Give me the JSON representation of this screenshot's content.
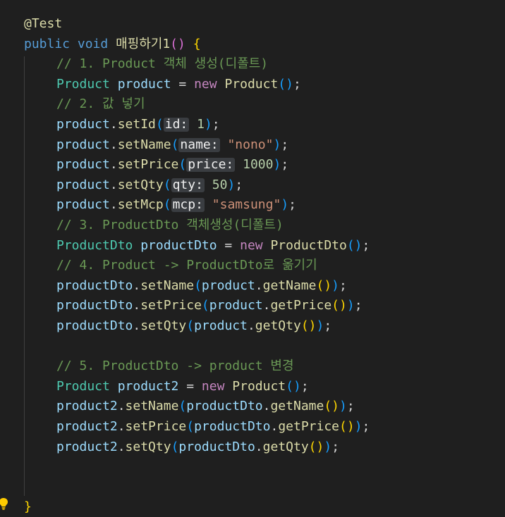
{
  "editor": {
    "colors": {
      "background": "#1f1f1f",
      "plain": "#d4d4d4",
      "keyword": "#569cd6",
      "control_keyword": "#c586c0",
      "type": "#4ec9b0",
      "variable": "#9cdcfe",
      "method": "#dcdcaa",
      "string": "#ce9178",
      "number": "#b5cea8",
      "comment": "#6a9955",
      "annotation": "#dcdcaa",
      "bracket_gold": "#ffd700",
      "bracket_purple": "#da70d6",
      "bracket_blue": "#179fff",
      "inlay_hint_bg": "#3a3d41",
      "lightbulb": "#ffcc00"
    },
    "lines": [
      {
        "indent": 0,
        "tokens": [
          {
            "t": "@Test",
            "k": "annotation"
          }
        ]
      },
      {
        "indent": 0,
        "tokens": [
          {
            "t": "public",
            "k": "keyword"
          },
          {
            "t": " ",
            "k": "plain"
          },
          {
            "t": "void",
            "k": "keyword"
          },
          {
            "t": " ",
            "k": "plain"
          },
          {
            "t": "매핑하기1",
            "k": "method"
          },
          {
            "t": "()",
            "k": "bracket_purple"
          },
          {
            "t": " ",
            "k": "plain"
          },
          {
            "t": "{",
            "k": "bracket_gold"
          }
        ]
      },
      {
        "indent": 1,
        "tokens": [
          {
            "t": "// 1. Product 객체 생성(디폴트)",
            "k": "comment"
          }
        ]
      },
      {
        "indent": 1,
        "tokens": [
          {
            "t": "Product",
            "k": "type"
          },
          {
            "t": " ",
            "k": "plain"
          },
          {
            "t": "product",
            "k": "variable"
          },
          {
            "t": " = ",
            "k": "plain"
          },
          {
            "t": "new",
            "k": "control_keyword"
          },
          {
            "t": " ",
            "k": "plain"
          },
          {
            "t": "Product",
            "k": "method"
          },
          {
            "t": "()",
            "k": "bracket_blue"
          },
          {
            "t": ";",
            "k": "plain"
          }
        ]
      },
      {
        "indent": 1,
        "tokens": [
          {
            "t": "// 2. 값 넣기",
            "k": "comment"
          }
        ]
      },
      {
        "indent": 1,
        "tokens": [
          {
            "t": "product",
            "k": "variable"
          },
          {
            "t": ".",
            "k": "plain"
          },
          {
            "t": "setId",
            "k": "method"
          },
          {
            "t": "(",
            "k": "bracket_blue"
          },
          {
            "t": "id:",
            "k": "hint"
          },
          {
            "t": " ",
            "k": "plain"
          },
          {
            "t": "1",
            "k": "number"
          },
          {
            "t": ")",
            "k": "bracket_blue"
          },
          {
            "t": ";",
            "k": "plain"
          }
        ]
      },
      {
        "indent": 1,
        "tokens": [
          {
            "t": "product",
            "k": "variable"
          },
          {
            "t": ".",
            "k": "plain"
          },
          {
            "t": "setName",
            "k": "method"
          },
          {
            "t": "(",
            "k": "bracket_blue"
          },
          {
            "t": "name:",
            "k": "hint"
          },
          {
            "t": " ",
            "k": "plain"
          },
          {
            "t": "\"nono\"",
            "k": "string"
          },
          {
            "t": ")",
            "k": "bracket_blue"
          },
          {
            "t": ";",
            "k": "plain"
          }
        ]
      },
      {
        "indent": 1,
        "tokens": [
          {
            "t": "product",
            "k": "variable"
          },
          {
            "t": ".",
            "k": "plain"
          },
          {
            "t": "setPrice",
            "k": "method"
          },
          {
            "t": "(",
            "k": "bracket_blue"
          },
          {
            "t": "price:",
            "k": "hint"
          },
          {
            "t": " ",
            "k": "plain"
          },
          {
            "t": "1000",
            "k": "number"
          },
          {
            "t": ")",
            "k": "bracket_blue"
          },
          {
            "t": ";",
            "k": "plain"
          }
        ]
      },
      {
        "indent": 1,
        "tokens": [
          {
            "t": "product",
            "k": "variable"
          },
          {
            "t": ".",
            "k": "plain"
          },
          {
            "t": "setQty",
            "k": "method"
          },
          {
            "t": "(",
            "k": "bracket_blue"
          },
          {
            "t": "qty:",
            "k": "hint"
          },
          {
            "t": " ",
            "k": "plain"
          },
          {
            "t": "50",
            "k": "number"
          },
          {
            "t": ")",
            "k": "bracket_blue"
          },
          {
            "t": ";",
            "k": "plain"
          }
        ]
      },
      {
        "indent": 1,
        "tokens": [
          {
            "t": "product",
            "k": "variable"
          },
          {
            "t": ".",
            "k": "plain"
          },
          {
            "t": "setMcp",
            "k": "method"
          },
          {
            "t": "(",
            "k": "bracket_blue"
          },
          {
            "t": "mcp:",
            "k": "hint"
          },
          {
            "t": " ",
            "k": "plain"
          },
          {
            "t": "\"samsung\"",
            "k": "string"
          },
          {
            "t": ")",
            "k": "bracket_blue"
          },
          {
            "t": ";",
            "k": "plain"
          }
        ]
      },
      {
        "indent": 1,
        "tokens": [
          {
            "t": "// 3. ProductDto 객체생성(디폴트)",
            "k": "comment"
          }
        ]
      },
      {
        "indent": 1,
        "tokens": [
          {
            "t": "ProductDto",
            "k": "type"
          },
          {
            "t": " ",
            "k": "plain"
          },
          {
            "t": "productDto",
            "k": "variable"
          },
          {
            "t": " = ",
            "k": "plain"
          },
          {
            "t": "new",
            "k": "control_keyword"
          },
          {
            "t": " ",
            "k": "plain"
          },
          {
            "t": "ProductDto",
            "k": "method"
          },
          {
            "t": "()",
            "k": "bracket_blue"
          },
          {
            "t": ";",
            "k": "plain"
          }
        ]
      },
      {
        "indent": 1,
        "tokens": [
          {
            "t": "// 4. Product -> ProductDto로 옮기기",
            "k": "comment"
          }
        ]
      },
      {
        "indent": 1,
        "tokens": [
          {
            "t": "productDto",
            "k": "variable"
          },
          {
            "t": ".",
            "k": "plain"
          },
          {
            "t": "setName",
            "k": "method"
          },
          {
            "t": "(",
            "k": "bracket_blue"
          },
          {
            "t": "product",
            "k": "variable"
          },
          {
            "t": ".",
            "k": "plain"
          },
          {
            "t": "getName",
            "k": "method"
          },
          {
            "t": "()",
            "k": "bracket_gold"
          },
          {
            "t": ")",
            "k": "bracket_blue"
          },
          {
            "t": ";",
            "k": "plain"
          }
        ]
      },
      {
        "indent": 1,
        "tokens": [
          {
            "t": "productDto",
            "k": "variable"
          },
          {
            "t": ".",
            "k": "plain"
          },
          {
            "t": "setPrice",
            "k": "method"
          },
          {
            "t": "(",
            "k": "bracket_blue"
          },
          {
            "t": "product",
            "k": "variable"
          },
          {
            "t": ".",
            "k": "plain"
          },
          {
            "t": "getPrice",
            "k": "method"
          },
          {
            "t": "()",
            "k": "bracket_gold"
          },
          {
            "t": ")",
            "k": "bracket_blue"
          },
          {
            "t": ";",
            "k": "plain"
          }
        ]
      },
      {
        "indent": 1,
        "tokens": [
          {
            "t": "productDto",
            "k": "variable"
          },
          {
            "t": ".",
            "k": "plain"
          },
          {
            "t": "setQty",
            "k": "method"
          },
          {
            "t": "(",
            "k": "bracket_blue"
          },
          {
            "t": "product",
            "k": "variable"
          },
          {
            "t": ".",
            "k": "plain"
          },
          {
            "t": "getQty",
            "k": "method"
          },
          {
            "t": "()",
            "k": "bracket_gold"
          },
          {
            "t": ")",
            "k": "bracket_blue"
          },
          {
            "t": ";",
            "k": "plain"
          }
        ]
      },
      {
        "indent": 0,
        "tokens": []
      },
      {
        "indent": 1,
        "tokens": [
          {
            "t": "// 5. ProductDto -> product 변경",
            "k": "comment"
          }
        ]
      },
      {
        "indent": 1,
        "tokens": [
          {
            "t": "Product",
            "k": "type"
          },
          {
            "t": " ",
            "k": "plain"
          },
          {
            "t": "product2",
            "k": "variable"
          },
          {
            "t": " = ",
            "k": "plain"
          },
          {
            "t": "new",
            "k": "control_keyword"
          },
          {
            "t": " ",
            "k": "plain"
          },
          {
            "t": "Product",
            "k": "method"
          },
          {
            "t": "()",
            "k": "bracket_blue"
          },
          {
            "t": ";",
            "k": "plain"
          }
        ]
      },
      {
        "indent": 1,
        "tokens": [
          {
            "t": "product2",
            "k": "variable"
          },
          {
            "t": ".",
            "k": "plain"
          },
          {
            "t": "setName",
            "k": "method"
          },
          {
            "t": "(",
            "k": "bracket_blue"
          },
          {
            "t": "productDto",
            "k": "variable"
          },
          {
            "t": ".",
            "k": "plain"
          },
          {
            "t": "getName",
            "k": "method"
          },
          {
            "t": "()",
            "k": "bracket_gold"
          },
          {
            "t": ")",
            "k": "bracket_blue"
          },
          {
            "t": ";",
            "k": "plain"
          }
        ]
      },
      {
        "indent": 1,
        "tokens": [
          {
            "t": "product2",
            "k": "variable"
          },
          {
            "t": ".",
            "k": "plain"
          },
          {
            "t": "setPrice",
            "k": "method"
          },
          {
            "t": "(",
            "k": "bracket_blue"
          },
          {
            "t": "productDto",
            "k": "variable"
          },
          {
            "t": ".",
            "k": "plain"
          },
          {
            "t": "getPrice",
            "k": "method"
          },
          {
            "t": "()",
            "k": "bracket_gold"
          },
          {
            "t": ")",
            "k": "bracket_blue"
          },
          {
            "t": ";",
            "k": "plain"
          }
        ]
      },
      {
        "indent": 1,
        "tokens": [
          {
            "t": "product2",
            "k": "variable"
          },
          {
            "t": ".",
            "k": "plain"
          },
          {
            "t": "setQty",
            "k": "method"
          },
          {
            "t": "(",
            "k": "bracket_blue"
          },
          {
            "t": "productDto",
            "k": "variable"
          },
          {
            "t": ".",
            "k": "plain"
          },
          {
            "t": "getQty",
            "k": "method"
          },
          {
            "t": "()",
            "k": "bracket_gold"
          },
          {
            "t": ")",
            "k": "bracket_blue"
          },
          {
            "t": ";",
            "k": "plain"
          }
        ]
      },
      {
        "indent": 0,
        "tokens": []
      },
      {
        "indent": 0,
        "tokens": []
      },
      {
        "indent": 0,
        "tokens": [
          {
            "t": "}",
            "k": "bracket_gold"
          }
        ]
      }
    ],
    "gutter": {
      "icon": "lightbulb-icon"
    }
  }
}
